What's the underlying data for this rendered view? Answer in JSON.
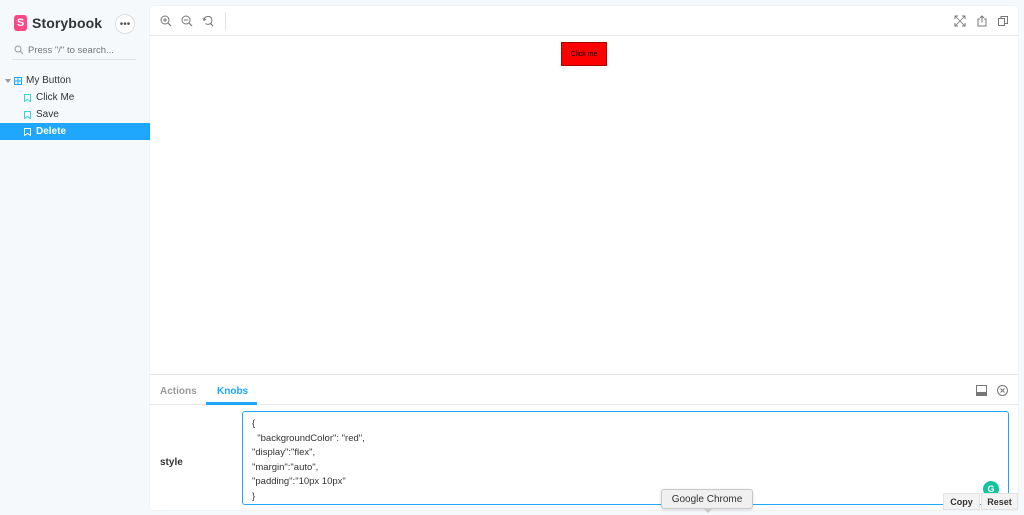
{
  "sidebar": {
    "brand": "Storybook",
    "logo_letter": "S",
    "menu_icon": "ellipsis-icon",
    "search": {
      "placeholder": "Press \"/\" to search..."
    },
    "tree": {
      "component": {
        "label": "My Button",
        "icon": "component-icon"
      },
      "stories": [
        {
          "label": "Click Me",
          "icon": "bookmark-icon",
          "selected": false
        },
        {
          "label": "Save",
          "icon": "bookmark-icon",
          "selected": false
        },
        {
          "label": "Delete",
          "icon": "bookmark-icon",
          "selected": true
        }
      ]
    }
  },
  "toolbar": {
    "left_tools": [
      "zoom-in-icon",
      "zoom-out-icon",
      "zoom-reset-icon"
    ],
    "right_tools": [
      "fullscreen-icon",
      "share-icon",
      "copy-icon"
    ]
  },
  "canvas": {
    "button_label": "Click me",
    "button_color": "#ff0000"
  },
  "addons": {
    "tabs": [
      {
        "label": "Actions",
        "active": false
      },
      {
        "label": "Knobs",
        "active": true
      }
    ],
    "right_icons": [
      "panel-position-icon",
      "close-panel-icon"
    ],
    "knob": {
      "label": "style",
      "lines": [
        "{",
        "  \"backgroundColor\": \"red\",",
        "\"display\":\"flex\",",
        "\"margin\":\"auto\",",
        "\"padding\":\"10px 10px\"",
        "}"
      ]
    },
    "copy_label": "Copy",
    "reset_label": "Reset"
  },
  "tooltip": {
    "text": "Google Chrome"
  },
  "colors": {
    "accent": "#1ea7fd",
    "brand": "#ff4785",
    "grammarly": "#15c39a"
  }
}
